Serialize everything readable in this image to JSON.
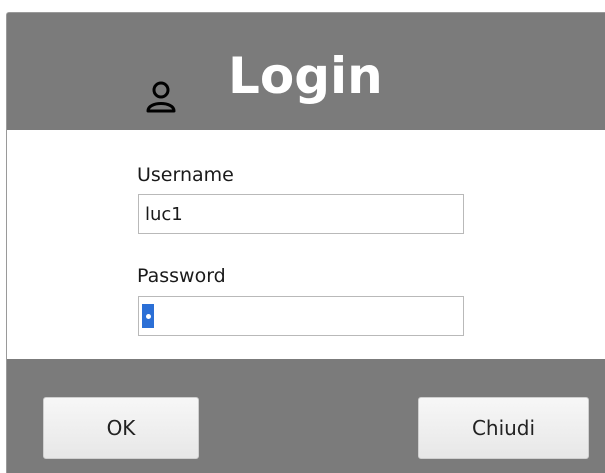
{
  "dialog": {
    "title": "Login",
    "icon": "user-icon"
  },
  "form": {
    "username_label": "Username",
    "username_value": "luc1",
    "password_label": "Password",
    "password_length": 1
  },
  "buttons": {
    "ok_label": "OK",
    "close_label": "Chiudi"
  },
  "colors": {
    "frame": "#7b7b7b",
    "panel": "#ffffff",
    "selection": "#2b6fd6",
    "title_text": "#ffffff"
  }
}
